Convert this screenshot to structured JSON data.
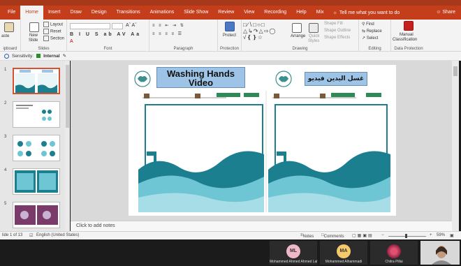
{
  "tabs": [
    "File",
    "Home",
    "Insert",
    "Draw",
    "Design",
    "Transitions",
    "Animations",
    "Slide Show",
    "Review",
    "View",
    "Recording",
    "Help",
    "Mix"
  ],
  "tell_me": "Tell me what you want to do",
  "share": "Share",
  "ribbon": {
    "clipboard": {
      "paste": "aste",
      "label": "ipboard"
    },
    "slides": {
      "new_slide": "New",
      "new_slide2": "Slide",
      "layout": "Layout",
      "reset": "Reset",
      "section": "Section",
      "label": "Slides"
    },
    "font": {
      "label": "Font"
    },
    "paragraph": {
      "label": "Paragraph"
    },
    "protection": {
      "protect": "Protect",
      "label": "Protection"
    },
    "drawing": {
      "arrange": "Arrange",
      "quick_styles": "Quick",
      "quick_styles2": "Styles",
      "shape_fill": "Shape Fill",
      "shape_outline": "Shape Outline",
      "shape_effects": "Shape Effects",
      "label": "Drawing"
    },
    "editing": {
      "find": "Find",
      "replace": "Replace",
      "select": "Select",
      "label": "Editing"
    },
    "data_protection": {
      "manual": "Manual",
      "classification": "Classification",
      "label": "Data Protection"
    }
  },
  "sensitivity": {
    "label": "Sensitivity:",
    "value": "Internal"
  },
  "thumbnails": [
    "1",
    "2",
    "3",
    "4",
    "5"
  ],
  "slide": {
    "title_en": "Washing Hands Video",
    "title_ar": "غسل اليدين فيديو"
  },
  "notes_placeholder": "Click to add notes",
  "status": {
    "slide_of": "lide 1 of 13",
    "language": "English (United States)",
    "notes": "Notes",
    "comments": "Comments",
    "zoom": "59%"
  },
  "participants": [
    {
      "initials": "ML",
      "name": "Mohammed Ahmed Ahmed Lalmahi",
      "color": "#f0b7c8"
    },
    {
      "initials": "MA",
      "name": "Mohammed Alhammadi",
      "color": "#f6c96b"
    },
    {
      "initials": "",
      "name": "Chitra Pillai",
      "color": "#b03050"
    },
    {
      "initials": "",
      "name": "",
      "color": "#dcdcdc"
    }
  ],
  "colors": {
    "accent": "#c43e1c",
    "teal_dark": "#1c7f8f",
    "teal_light": "#6ec6d4"
  }
}
